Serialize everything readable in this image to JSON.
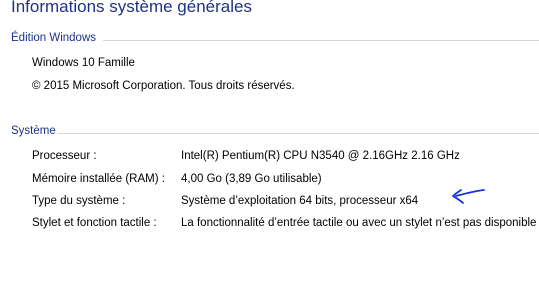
{
  "page": {
    "title": "Informations système générales"
  },
  "edition": {
    "header": "Édition Windows",
    "name": "Windows 10 Famille",
    "copyright": "© 2015 Microsoft Corporation. Tous droits réservés."
  },
  "system": {
    "header": "Système",
    "rows": [
      {
        "label": "Processeur :",
        "value": "Intel(R) Pentium(R) CPU  N3540  @ 2.16GHz   2.16 GHz"
      },
      {
        "label": "Mémoire installée (RAM) :",
        "value": "4,00 Go (3,89 Go utilisable)"
      },
      {
        "label": "Type du système :",
        "value": "Système d’exploitation 64 bits, processeur x64"
      },
      {
        "label": "Stylet et fonction tactile :",
        "value": "La fonctionnalité d’entrée tactile ou avec un stylet n’est pas disponible"
      }
    ]
  },
  "colors": {
    "heading": "#1e3287",
    "annotation": "#1a35d6"
  },
  "icons": {
    "annotation": "hand-drawn-arrow-icon"
  }
}
